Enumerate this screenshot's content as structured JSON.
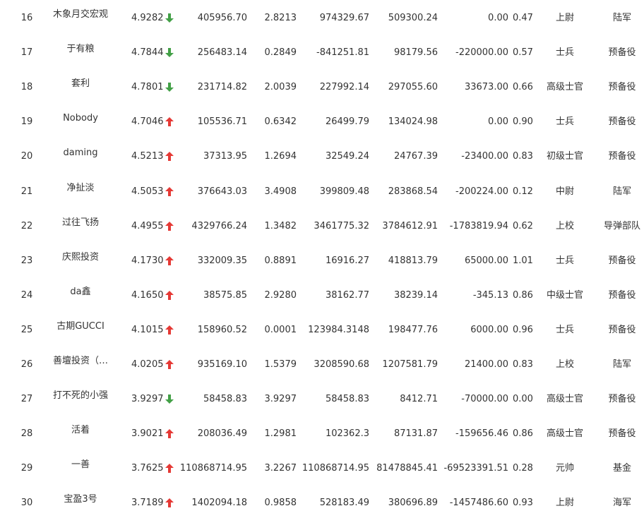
{
  "colors": {
    "up": "#e53935",
    "down": "#43a047",
    "text": "#333333"
  },
  "rows": [
    {
      "rank": "16",
      "name": "木象月交宏观",
      "score": "4.9282",
      "trend": "down",
      "v1": "405956.70",
      "v2": "2.8213",
      "v3": "974329.67",
      "v4": "509300.24",
      "v5": "0.00",
      "v6": "0.47",
      "military_rank": "上尉",
      "unit": "陆军"
    },
    {
      "rank": "17",
      "name": "于有粮",
      "score": "4.7844",
      "trend": "down",
      "v1": "256483.14",
      "v2": "0.2849",
      "v3": "-841251.81",
      "v4": "98179.56",
      "v5": "-220000.00",
      "v6": "0.57",
      "military_rank": "士兵",
      "unit": "预备役"
    },
    {
      "rank": "18",
      "name": "套利",
      "score": "4.7801",
      "trend": "down",
      "v1": "231714.82",
      "v2": "2.0039",
      "v3": "227992.14",
      "v4": "297055.60",
      "v5": "33673.00",
      "v6": "0.66",
      "military_rank": "高级士官",
      "unit": "预备役"
    },
    {
      "rank": "19",
      "name": "Nobody",
      "score": "4.7046",
      "trend": "up",
      "v1": "105536.71",
      "v2": "0.6342",
      "v3": "26499.79",
      "v4": "134024.98",
      "v5": "0.00",
      "v6": "0.90",
      "military_rank": "士兵",
      "unit": "预备役"
    },
    {
      "rank": "20",
      "name": "daming",
      "score": "4.5213",
      "trend": "up",
      "v1": "37313.95",
      "v2": "1.2694",
      "v3": "32549.24",
      "v4": "24767.39",
      "v5": "-23400.00",
      "v6": "0.83",
      "military_rank": "初级士官",
      "unit": "预备役"
    },
    {
      "rank": "21",
      "name": "净扯淡",
      "score": "4.5053",
      "trend": "up",
      "v1": "376643.03",
      "v2": "3.4908",
      "v3": "399809.48",
      "v4": "283868.54",
      "v5": "-200224.00",
      "v6": "0.12",
      "military_rank": "中尉",
      "unit": "陆军"
    },
    {
      "rank": "22",
      "name": "过往飞扬",
      "score": "4.4955",
      "trend": "up",
      "v1": "4329766.24",
      "v2": "1.3482",
      "v3": "3461775.32",
      "v4": "3784612.91",
      "v5": "-1783819.94",
      "v6": "0.62",
      "military_rank": "上校",
      "unit": "导弹部队"
    },
    {
      "rank": "23",
      "name": "庆熙投资",
      "score": "4.1730",
      "trend": "up",
      "v1": "332009.35",
      "v2": "0.8891",
      "v3": "16916.27",
      "v4": "418813.79",
      "v5": "65000.00",
      "v6": "1.01",
      "military_rank": "士兵",
      "unit": "预备役"
    },
    {
      "rank": "24",
      "name": "da鑫",
      "score": "4.1650",
      "trend": "up",
      "v1": "38575.85",
      "v2": "2.9280",
      "v3": "38162.77",
      "v4": "38239.14",
      "v5": "-345.13",
      "v6": "0.86",
      "military_rank": "中级士官",
      "unit": "预备役"
    },
    {
      "rank": "25",
      "name": "古期GUCCI",
      "score": "4.1015",
      "trend": "up",
      "v1": "158960.52",
      "v2": "0.0001",
      "v3": "123984.3148",
      "v4": "198477.76",
      "v5": "6000.00",
      "v6": "0.96",
      "military_rank": "士兵",
      "unit": "预备役"
    },
    {
      "rank": "26",
      "name": "善壇投资（…",
      "score": "4.0205",
      "trend": "up",
      "v1": "935169.10",
      "v2": "1.5379",
      "v3": "3208590.68",
      "v4": "1207581.79",
      "v5": "21400.00",
      "v6": "0.83",
      "military_rank": "上校",
      "unit": "陆军"
    },
    {
      "rank": "27",
      "name": "打不死的小强",
      "score": "3.9297",
      "trend": "down",
      "v1": "58458.83",
      "v2": "3.9297",
      "v3": "58458.83",
      "v4": "8412.71",
      "v5": "-70000.00",
      "v6": "0.00",
      "military_rank": "高级士官",
      "unit": "预备役"
    },
    {
      "rank": "28",
      "name": "活着",
      "score": "3.9021",
      "trend": "up",
      "v1": "208036.49",
      "v2": "1.2981",
      "v3": "102362.3",
      "v4": "87131.87",
      "v5": "-159656.46",
      "v6": "0.86",
      "military_rank": "高级士官",
      "unit": "预备役"
    },
    {
      "rank": "29",
      "name": "一善",
      "score": "3.7625",
      "trend": "up",
      "v1": "110868714.95",
      "v2": "3.2267",
      "v3": "110868714.95",
      "v4": "81478845.41",
      "v5": "-69523391.51",
      "v6": "0.28",
      "military_rank": "元帅",
      "unit": "基金"
    },
    {
      "rank": "30",
      "name": "宝盈3号",
      "score": "3.7189",
      "trend": "up",
      "v1": "1402094.18",
      "v2": "0.9858",
      "v3": "528183.49",
      "v4": "380696.89",
      "v5": "-1457486.60",
      "v6": "0.93",
      "military_rank": "上尉",
      "unit": "海军"
    }
  ]
}
